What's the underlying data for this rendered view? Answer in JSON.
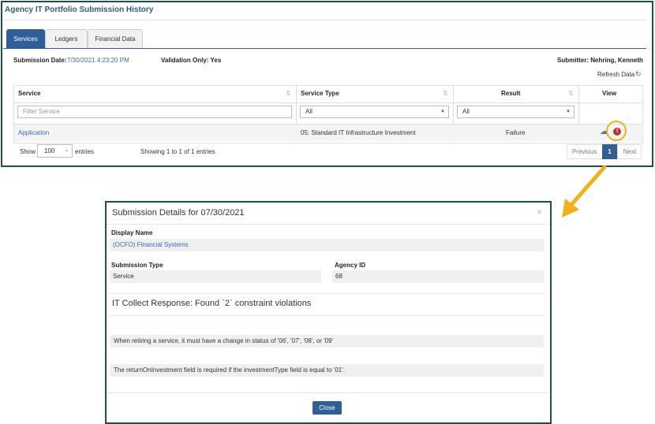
{
  "panel": {
    "title": "Agency IT Portfolio Submission History",
    "tabs": [
      {
        "label": "Services",
        "active": true
      },
      {
        "label": "Ledgers",
        "active": false
      },
      {
        "label": "Financial Data",
        "active": false
      }
    ],
    "submission_date_label": "Submission Date:",
    "submission_date_value": "7/30/2021 4:23:20 PM",
    "validation_only": "Validation Only: Yes",
    "submitter": "Submitter: Nehring, Kenneth",
    "refresh_label": "Refresh Data"
  },
  "table": {
    "headers": {
      "service": "Service",
      "service_type": "Service Type",
      "result": "Result",
      "view": "View"
    },
    "filters": {
      "service_placeholder": "Filter Service",
      "service_type": "All",
      "result": "All"
    },
    "rows": [
      {
        "service": "Application",
        "service_type": "05: Standard IT Infrastructure Investment",
        "result": "Failure"
      }
    ],
    "show_label": "Show",
    "page_size": "100",
    "entries_label": "entries",
    "showing": "Showing 1 to 1 of 1 entries",
    "pagination": {
      "previous": "Previous",
      "current": "1",
      "next": "Next"
    }
  },
  "modal": {
    "title": "Submission Details for 07/30/2021",
    "close_x": "×",
    "display_name_label": "Display Name",
    "display_name_value": "(OCFO) Financial Systems",
    "submission_type_label": "Submission Type",
    "submission_type_value": "Service",
    "agency_id_label": "Agency ID",
    "agency_id_value": "68",
    "response_heading": "IT Collect Response: Found `2` constraint violations",
    "violations": [
      "When retiring a service, it must have a change in status of '06', '07', '08', or '09'",
      "The returnOnInvestment field is required if the investmentType field is equal to '01'."
    ],
    "close_button": "Close"
  },
  "colors": {
    "accent": "#2f5f96",
    "link": "#2e6fb5",
    "highlight": "#f0b21a",
    "frame": "#1f4e4e",
    "error": "#b03a2e"
  },
  "icons": [
    "sort-icon",
    "refresh-icon",
    "chevron-down-icon",
    "cloud-upload-icon",
    "error-icon",
    "close-icon",
    "arrow-icon"
  ]
}
